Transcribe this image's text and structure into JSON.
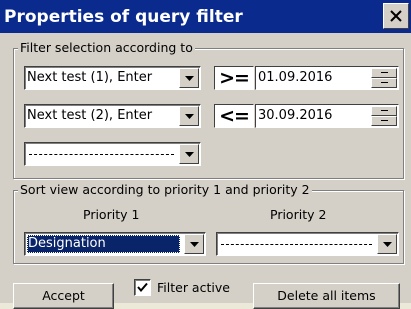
{
  "window": {
    "title": "Properties of query filter",
    "close_icon": "close-icon"
  },
  "filter_selection": {
    "group_title": "Filter selection according to",
    "row1": {
      "field": "Next test (1), Enter",
      "operator": ">=",
      "date": "01.09.2016"
    },
    "row2": {
      "field": "Next test (2), Enter",
      "operator": "<=",
      "date": "30.09.2016"
    },
    "row3": {
      "field": ""
    }
  },
  "sort_view": {
    "group_title": "Sort view according to priority 1 and priority 2",
    "priority1": {
      "label": "Priority 1",
      "value": "Designation"
    },
    "priority2": {
      "label": "Priority 2",
      "value": ""
    }
  },
  "footer": {
    "accept_label": "Accept",
    "filter_active_label": "Filter active",
    "filter_active_checked": true,
    "delete_label": "Delete all items"
  },
  "colors": {
    "titlebar": "#0a2a8e",
    "face": "#d4d0c8",
    "selection": "#0a246a"
  }
}
